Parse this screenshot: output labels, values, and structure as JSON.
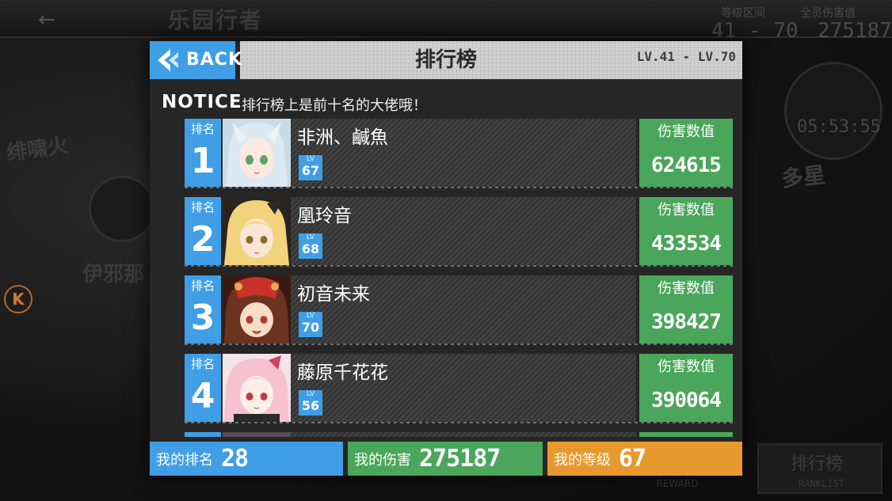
{
  "background": {
    "title": "乐园行者",
    "level_range_label": "等级区间",
    "level_range_value": "41 - 70",
    "total_damage_label": "全员伤害值",
    "total_damage_value": "275187",
    "left_card_name": "绯啸火",
    "left_card_name2": "伊邪那",
    "k_icon": "K",
    "timer": "05:53:55",
    "right_card_name": "多星",
    "rank_button_label": "排行榜",
    "rank_button_sub": "RANKLIST",
    "reward_label": "REWARD"
  },
  "header": {
    "back_label": "BACK",
    "title": "排行榜",
    "level_range": "LV.41 - LV.70"
  },
  "notice": {
    "label": "NOTICE",
    "text": "排行榜上是前十名的大佬哦！"
  },
  "ranking": [
    {
      "rank_label": "排名",
      "rank": "1",
      "name": "非洲、鹹魚",
      "lv_label": "LV",
      "level": "67",
      "damage_label": "伤害数值",
      "damage": "624615"
    },
    {
      "rank_label": "排名",
      "rank": "2",
      "name": "凰玲音",
      "lv_label": "LV",
      "level": "68",
      "damage_label": "伤害数值",
      "damage": "433534"
    },
    {
      "rank_label": "排名",
      "rank": "3",
      "name": "初音未来",
      "lv_label": "LV",
      "level": "70",
      "damage_label": "伤害数值",
      "damage": "398427"
    },
    {
      "rank_label": "排名",
      "rank": "4",
      "name": "藤原千花花",
      "lv_label": "LV",
      "level": "56",
      "damage_label": "伤害数值",
      "damage": "390064"
    }
  ],
  "footer": {
    "my_rank_label": "我的排名",
    "my_rank": "28",
    "my_damage_label": "我的伤害",
    "my_damage": "275187",
    "my_level_label": "我的等级",
    "my_level": "67"
  },
  "colors": {
    "accent_blue": "#3f9ee6",
    "accent_green": "#4aa65a",
    "accent_orange": "#e8992e"
  }
}
